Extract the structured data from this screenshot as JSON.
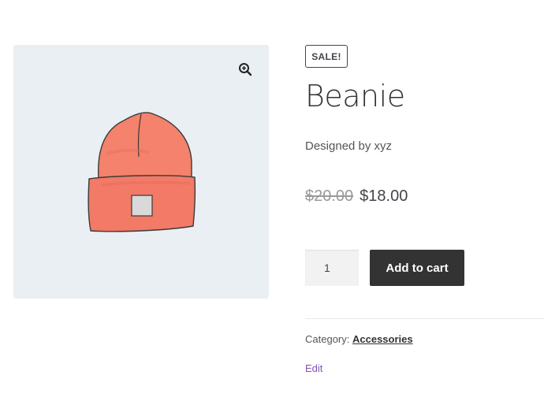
{
  "product": {
    "sale_badge": "SALE!",
    "title": "Beanie",
    "short_description": "Designed by xyz",
    "regular_price": "$20.00",
    "sale_price": "$18.00",
    "quantity": "1",
    "add_to_cart_label": "Add to cart",
    "category_label": "Category:",
    "category_name": "Accessories",
    "edit_label": "Edit"
  },
  "gallery": {
    "zoom_icon": "magnifier-plus-icon"
  },
  "colors": {
    "gallery_bg": "#eaeff3",
    "beanie": "#f4826c",
    "button_bg": "#333333",
    "edit_link": "#7f54b3"
  }
}
